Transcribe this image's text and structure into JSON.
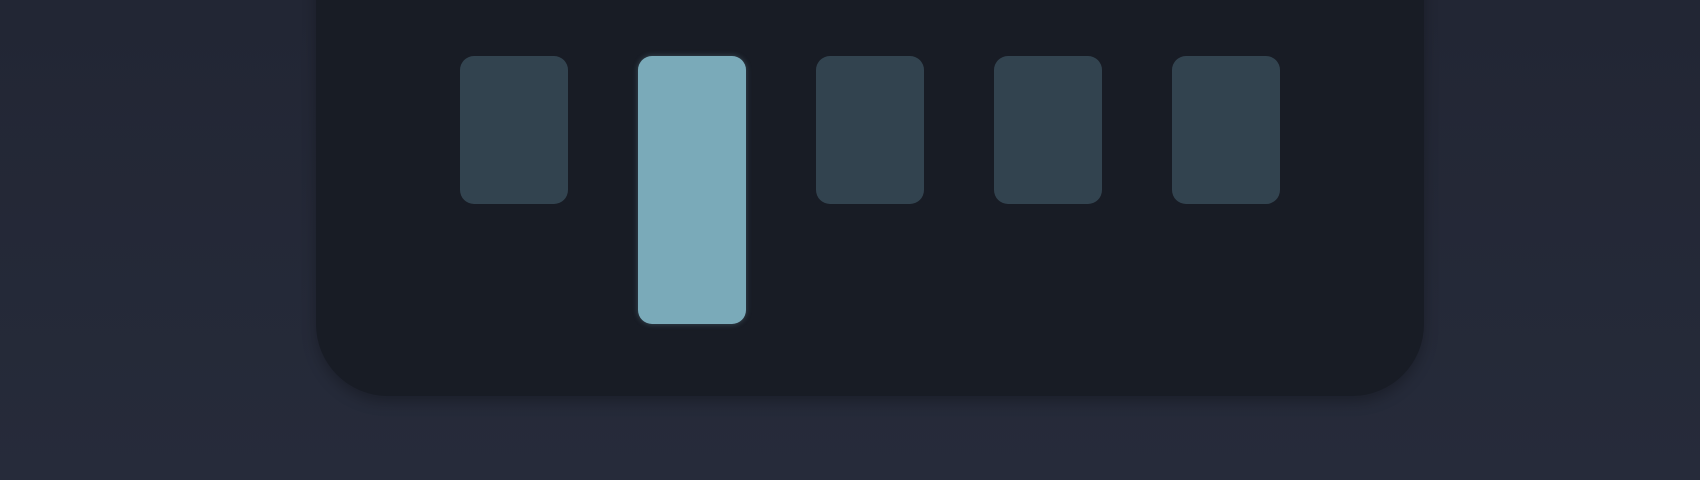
{
  "selector": {
    "options": [
      {
        "id": "option-1",
        "selected": false
      },
      {
        "id": "option-2",
        "selected": true
      },
      {
        "id": "option-3",
        "selected": false
      },
      {
        "id": "option-4",
        "selected": false
      },
      {
        "id": "option-5",
        "selected": false
      }
    ],
    "colors": {
      "panel": "#181c25",
      "background": "#252a39",
      "inactive": "#32434f",
      "active": "#7aaab9"
    }
  }
}
